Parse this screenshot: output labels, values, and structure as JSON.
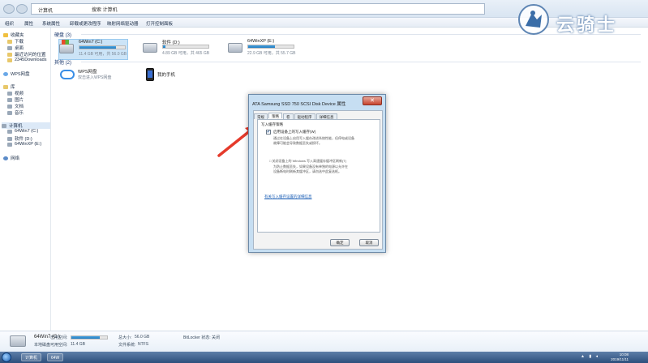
{
  "window": {
    "address": "计算机",
    "search_placeholder": "搜索 计算机"
  },
  "toolbar": {
    "items": [
      "组织",
      "属性",
      "系统属性",
      "卸载或更改程序",
      "映射网络驱动器",
      "打开控制面板"
    ]
  },
  "sidebar": {
    "favorites_label": "收藏夹",
    "favorites": [
      "下载",
      "桌面",
      "最近访问的位置",
      "2345Downloads"
    ],
    "wps_label": "WPS网盘",
    "libraries_label": "库",
    "libraries": [
      "视频",
      "图片",
      "文档",
      "音乐"
    ],
    "computer_label": "计算机",
    "drives": [
      "64Win7 (C:)",
      "软件 (D:)",
      "64WinXP (E:)"
    ],
    "network_label": "网络"
  },
  "main": {
    "hard_disks_header": "硬盘 (3)",
    "other_header": "其他 (2)",
    "drives": [
      {
        "name": "64Win7 (C:)",
        "info": "11.4 GB 可用，共 56.0 GB",
        "used_fraction": 0.8
      },
      {
        "name": "软件 (D:)",
        "info": "4.89 GB 可用，共 465 GB",
        "used_fraction": 0.05
      },
      {
        "name": "64WinXP (E:)",
        "info": "22.9 GB 可用，共 55.7 GB",
        "used_fraction": 0.59
      }
    ],
    "others": [
      {
        "name": "WPS网盘",
        "sub": "双击进入WPS网盘"
      },
      {
        "name": "我的手机",
        "sub": ""
      }
    ]
  },
  "dialog": {
    "title": "ATA Samsung SSD 750 SCSI Disk Device 属性",
    "close_glyph": "✕",
    "tabs": [
      "常规",
      "策略",
      "卷",
      "驱动程序",
      "详细信息"
    ],
    "active_tab": 1,
    "group_title": "写入缓存策略",
    "check_mark": "✔",
    "checkbox_label": "启用设备上的写入缓存(W)",
    "para1_line1": "通过在设备上启用写入缓存改进系统性能，但停电或设备",
    "para1_line2": "故障可能会导致数据丢失或损坏。",
    "para2_line1": "□ 关闭设备上的 Windows 写入高速缓存缓冲区刷新(T)",
    "para2_line2": "为防止数据丢失，如果设备没有单独的电源以允许在",
    "para2_line3": "设备断电时刷新其缓冲区，请勿选中此复选框。",
    "link": "有关写入缓存设置的详细信息",
    "ok": "确定",
    "cancel": "取消"
  },
  "details": {
    "drive_name": "64Win7 (C:)",
    "drive_type": "本地磁盘",
    "used_label": "已用空间:",
    "free_label": "可用空间:",
    "free_value": "11.4 GB",
    "total_label": "总大小:",
    "total_value": "56.0 GB",
    "fs_label": "文件系统:",
    "fs_value": "NTFS",
    "bitlocker": "BitLocker 状态: 关闭",
    "used_fraction": 0.8
  },
  "taskbar": {
    "tasks": [
      "计算机",
      "64W"
    ],
    "time": "10:08",
    "date": "2019/11/11"
  },
  "watermark": {
    "text": "云骑士"
  },
  "colors": {
    "accent": "#1e7cc2",
    "arrow": "#e53a2b",
    "link": "#1c5fb6"
  }
}
